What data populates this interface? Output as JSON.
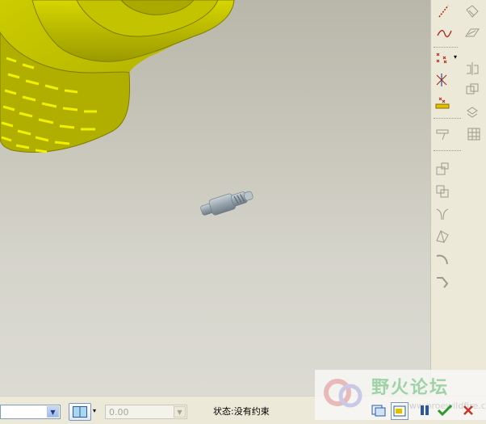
{
  "status": {
    "text": "状态:没有约束"
  },
  "bottom": {
    "offset_value": "0.00",
    "reference_combo_value": ""
  },
  "watermark": {
    "text": "野火论坛",
    "url": "www.proewildfire.cn"
  },
  "toolbar_right": {
    "items": [
      {
        "name": "sketch-line-icon"
      },
      {
        "name": "datum-plane-icon"
      },
      {
        "name": "sketch-curve-icon"
      },
      {
        "name": "surface-icon"
      },
      {
        "name": "datum-points-icon"
      },
      {
        "name": "mirror-icon"
      },
      {
        "name": "datum-axis-icon"
      },
      {
        "name": "offset-icon"
      },
      {
        "name": "coordinate-system-icon"
      },
      {
        "name": "copy-icon"
      },
      {
        "name": "insert-feature-icon"
      },
      {
        "name": "table-icon"
      },
      {
        "name": "component-place-icon"
      },
      {
        "name": "group-icon"
      },
      {
        "name": "merge-icon"
      },
      {
        "name": "cut-out-icon"
      },
      {
        "name": "bend-icon"
      },
      {
        "name": "flange-icon"
      }
    ]
  },
  "colors": {
    "model_yellow": "#c8c800",
    "model_yellow_dark": "#8a8a00",
    "viewport_top": "#b9b7aa",
    "viewport_bottom": "#dcdbd3",
    "accent_green": "#2e9a2e",
    "cancel_red": "#c0392b"
  }
}
